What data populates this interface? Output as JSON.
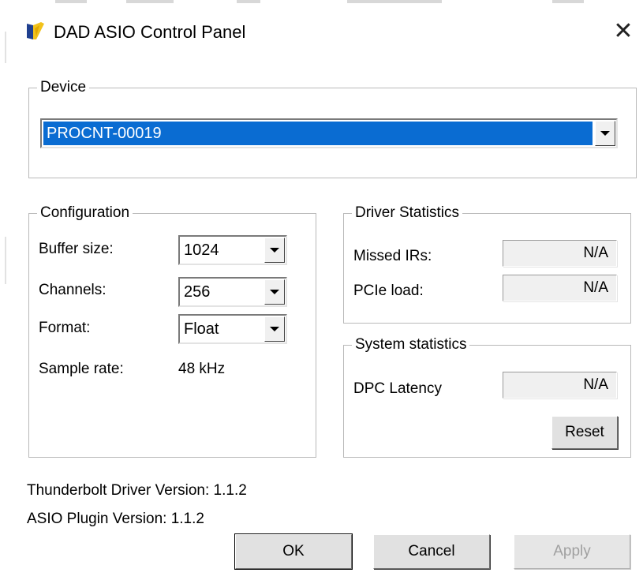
{
  "window": {
    "title": "DAD ASIO Control Panel",
    "close_symbol": "✕",
    "app_icon": "dad-logo-icon"
  },
  "device": {
    "group_title": "Device",
    "selected": "PROCNT-00019"
  },
  "configuration": {
    "group_title": "Configuration",
    "buffer_size": {
      "label": "Buffer size:",
      "value": "1024"
    },
    "channels": {
      "label": "Channels:",
      "value": "256"
    },
    "format": {
      "label": "Format:",
      "value": "Float"
    },
    "sample_rate": {
      "label": "Sample rate:",
      "value": "48 kHz"
    }
  },
  "driver_statistics": {
    "group_title": "Driver Statistics",
    "missed_irs": {
      "label": "Missed IRs:",
      "value": "N/A"
    },
    "pcie_load": {
      "label": "PCIe load:",
      "value": "N/A"
    }
  },
  "system_statistics": {
    "group_title": "System statistics",
    "dpc_latency": {
      "label": "DPC Latency",
      "value": "N/A"
    },
    "reset_label": "Reset"
  },
  "versions": {
    "thunderbolt": "Thunderbolt Driver Version: 1.1.2",
    "asio_plugin": "ASIO Plugin Version: 1.1.2"
  },
  "buttons": {
    "ok": "OK",
    "cancel": "Cancel",
    "apply": "Apply"
  },
  "colors": {
    "selection": "#0a6cd2",
    "group_border": "#b9b9b9",
    "disabled_text": "#a0a0a0"
  }
}
